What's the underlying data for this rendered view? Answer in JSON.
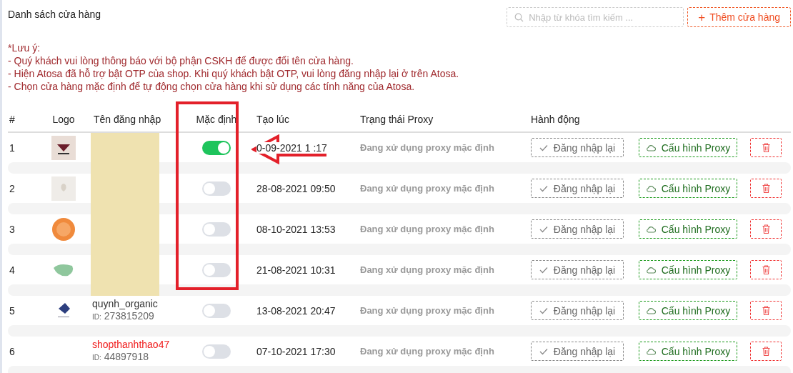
{
  "title": "Danh sách cửa hàng",
  "search": {
    "placeholder": "Nhập từ khóa tìm kiếm ..."
  },
  "add_button": {
    "icon": "+",
    "label": "Thêm cửa hàng"
  },
  "notes": [
    "*Lưu ý:",
    "- Quý khách vui lòng thông báo với bộ phận CSKH để được đổi tên cửa hàng.",
    "- Hiện Atosa đã hỗ trợ bật OTP của shop. Khi quý khách bật OTP, vui lòng đăng nhập lại ở trên Atosa.",
    "- Chọn cửa hàng mặc định để tự động chọn cửa hàng khi sử dụng các tính năng của Atosa."
  ],
  "table": {
    "columns": [
      "#",
      "Logo",
      "Tên đăng nhập",
      "Mặc định",
      "Tạo lúc",
      "Trạng thái Proxy",
      "Hành động"
    ],
    "rows": [
      {
        "index": "1",
        "redacted": true,
        "default": true,
        "created": "0-09-2021 1  :17",
        "proxy": "Đang xử dụng proxy mặc định",
        "relogin": "Đăng nhập lại",
        "proxy_button": "Cấu hình Proxy"
      },
      {
        "index": "2",
        "redacted": true,
        "default": false,
        "created": "28-08-2021 09:50",
        "proxy": "Đang xử dụng proxy mặc định",
        "relogin": "Đăng nhập lại",
        "proxy_button": "Cấu hình Proxy"
      },
      {
        "index": "3",
        "redacted": true,
        "default": false,
        "created": "08-10-2021 13:53",
        "proxy": "Đang xử dụng proxy mặc định",
        "relogin": "Đăng nhập lại",
        "proxy_button": "Cấu hình Proxy"
      },
      {
        "index": "4",
        "redacted": true,
        "default": false,
        "created": "21-08-2021 10:31",
        "proxy": "Đang xử dụng proxy mặc định",
        "relogin": "Đăng nhập lại",
        "proxy_button": "Cấu hình Proxy"
      },
      {
        "index": "5",
        "redacted": false,
        "username": "quynh_organic",
        "id_label": "ID:",
        "id": "273815209",
        "name_alert": false,
        "default": false,
        "created": "13-08-2021 20:47",
        "proxy": "Đang xử dụng proxy mặc định",
        "relogin": "Đăng nhập lại",
        "proxy_button": "Cấu hình Proxy"
      },
      {
        "index": "6",
        "redacted": false,
        "username": "shopthanhthao47",
        "id_label": "ID:",
        "id": "44897918",
        "name_alert": true,
        "default": false,
        "created": "07-10-2021 17:30",
        "proxy": "Đang xử dụng proxy mặc định",
        "relogin": "Đăng nhập lại",
        "proxy_button": "Cấu hình Proxy"
      }
    ]
  },
  "annotations": {
    "highlight_box": true,
    "arrow": true
  }
}
